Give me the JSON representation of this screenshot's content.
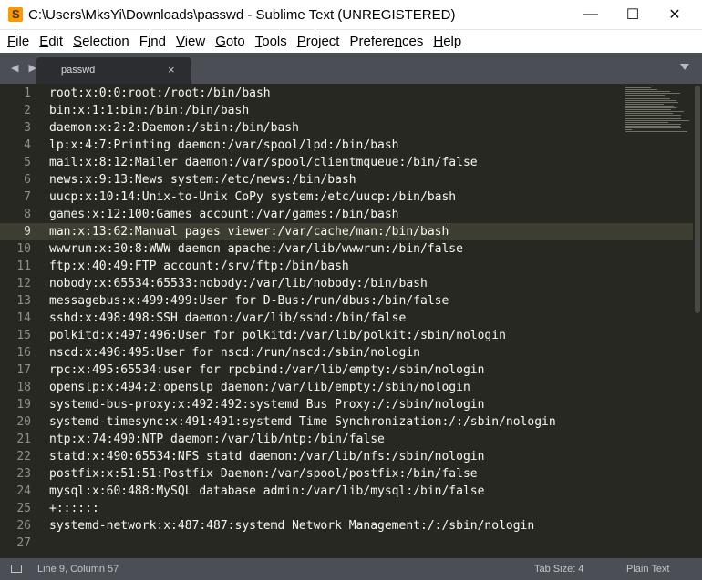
{
  "window": {
    "title": "C:\\Users\\MksYi\\Downloads\\passwd - Sublime Text (UNREGISTERED)",
    "minimize_glyph": "—",
    "maximize_glyph": "☐",
    "close_glyph": "✕"
  },
  "menu": {
    "items": [
      {
        "pre": "",
        "u": "F",
        "post": "ile"
      },
      {
        "pre": "",
        "u": "E",
        "post": "dit"
      },
      {
        "pre": "",
        "u": "S",
        "post": "election"
      },
      {
        "pre": "F",
        "u": "i",
        "post": "nd"
      },
      {
        "pre": "",
        "u": "V",
        "post": "iew"
      },
      {
        "pre": "",
        "u": "G",
        "post": "oto"
      },
      {
        "pre": "",
        "u": "T",
        "post": "ools"
      },
      {
        "pre": "",
        "u": "P",
        "post": "roject"
      },
      {
        "pre": "Prefere",
        "u": "n",
        "post": "ces"
      },
      {
        "pre": "",
        "u": "H",
        "post": "elp"
      }
    ]
  },
  "tabs": {
    "nav_arrows": "◀ ▶",
    "active_tab_label": "passwd",
    "close_glyph": "×"
  },
  "editor": {
    "active_line": 9,
    "lines": [
      "root:x:0:0:root:/root:/bin/bash",
      "bin:x:1:1:bin:/bin:/bin/bash",
      "daemon:x:2:2:Daemon:/sbin:/bin/bash",
      "lp:x:4:7:Printing daemon:/var/spool/lpd:/bin/bash",
      "mail:x:8:12:Mailer daemon:/var/spool/clientmqueue:/bin/false",
      "news:x:9:13:News system:/etc/news:/bin/bash",
      "uucp:x:10:14:Unix-to-Unix CoPy system:/etc/uucp:/bin/bash",
      "games:x:12:100:Games account:/var/games:/bin/bash",
      "man:x:13:62:Manual pages viewer:/var/cache/man:/bin/bash",
      "wwwrun:x:30:8:WWW daemon apache:/var/lib/wwwrun:/bin/false",
      "ftp:x:40:49:FTP account:/srv/ftp:/bin/bash",
      "nobody:x:65534:65533:nobody:/var/lib/nobody:/bin/bash",
      "messagebus:x:499:499:User for D-Bus:/run/dbus:/bin/false",
      "sshd:x:498:498:SSH daemon:/var/lib/sshd:/bin/false",
      "polkitd:x:497:496:User for polkitd:/var/lib/polkit:/sbin/nologin",
      "nscd:x:496:495:User for nscd:/run/nscd:/sbin/nologin",
      "rpc:x:495:65534:user for rpcbind:/var/lib/empty:/sbin/nologin",
      "openslp:x:494:2:openslp daemon:/var/lib/empty:/sbin/nologin",
      "systemd-bus-proxy:x:492:492:systemd Bus Proxy:/:/sbin/nologin",
      "systemd-timesync:x:491:491:systemd Time Synchronization:/:/sbin/nologin",
      "ntp:x:74:490:NTP daemon:/var/lib/ntp:/bin/false",
      "statd:x:490:65534:NFS statd daemon:/var/lib/nfs:/sbin/nologin",
      "postfix:x:51:51:Postfix Daemon:/var/spool/postfix:/bin/false",
      "mysql:x:60:488:MySQL database admin:/var/lib/mysql:/bin/false",
      "+::::::",
      "systemd-network:x:487:487:systemd Network Management:/:/sbin/nologin",
      ""
    ]
  },
  "status": {
    "position": "Line 9, Column 57",
    "tab_size": "Tab Size: 4",
    "syntax": "Plain Text"
  },
  "colors": {
    "editor_bg": "#272822",
    "text": "#f8f8f2",
    "chrome": "#4b4f55"
  }
}
